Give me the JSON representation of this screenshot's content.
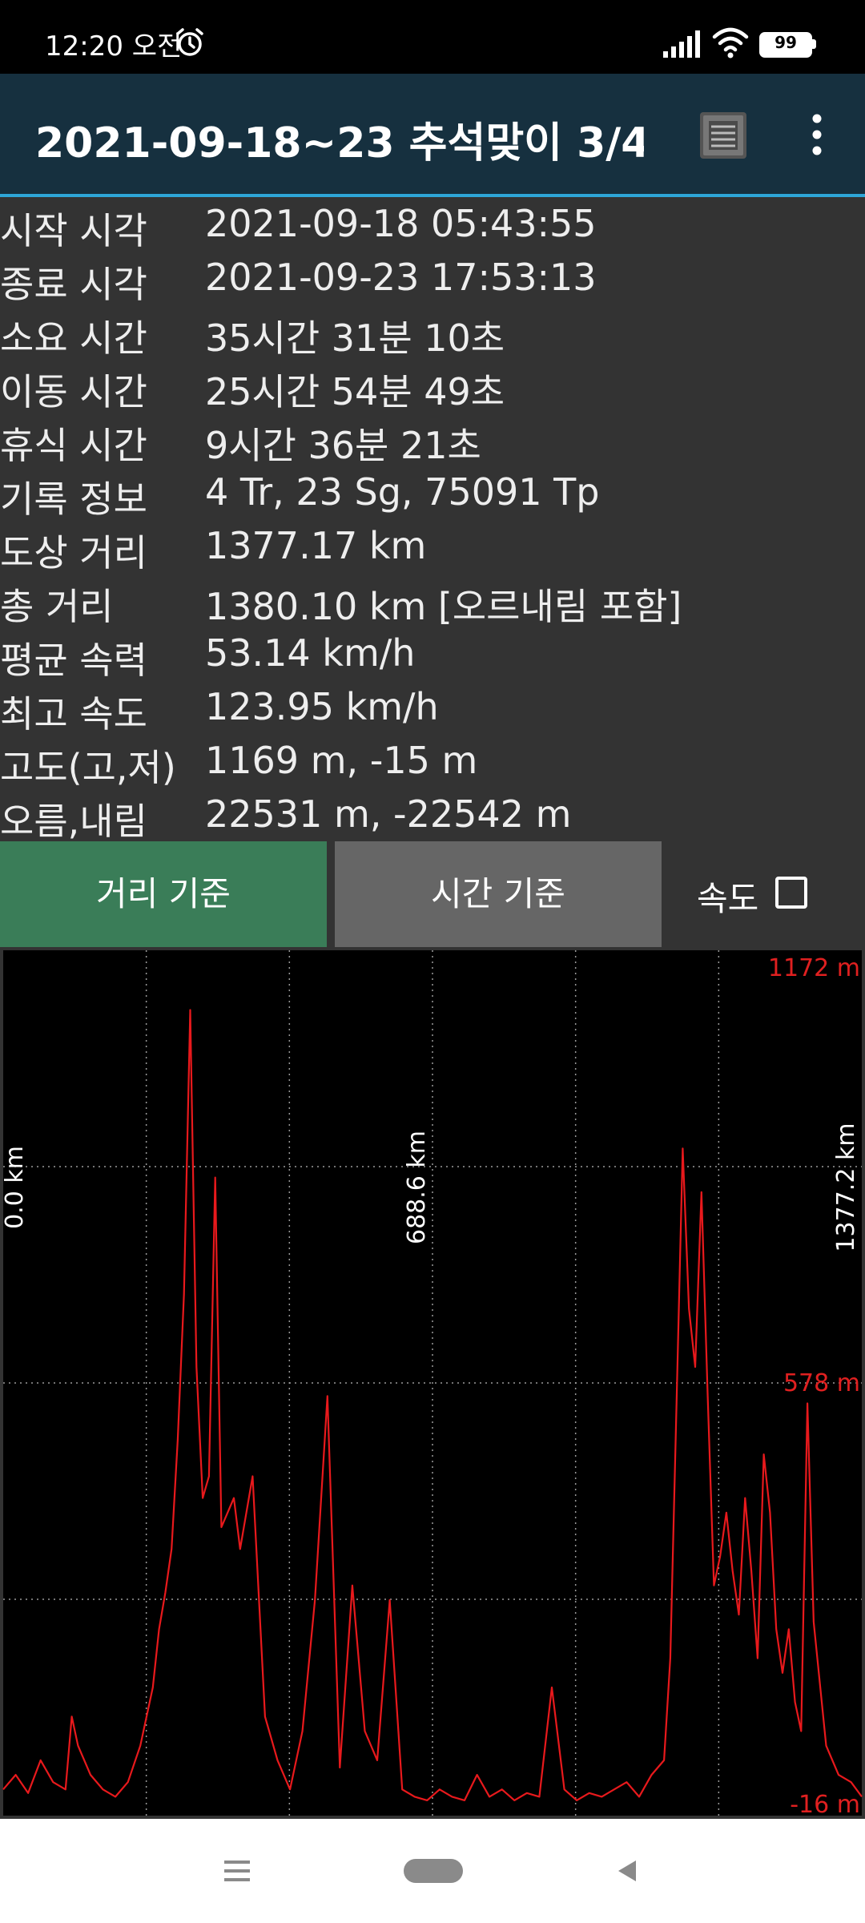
{
  "status_bar": {
    "time": "12:20 오전",
    "battery": "99"
  },
  "header": {
    "title": "2021-09-18~23 추석맞이 3/4..."
  },
  "info_rows": [
    {
      "label": "시작 시각",
      "value": "2021-09-18 05:43:55"
    },
    {
      "label": "종료 시각",
      "value": "2021-09-23 17:53:13"
    },
    {
      "label": "소요 시간",
      "value": "35시간 31분 10초"
    },
    {
      "label": "이동 시간",
      "value": "25시간 54분 49초"
    },
    {
      "label": "휴식 시간",
      "value": "9시간 36분 21초"
    },
    {
      "label": "기록 정보",
      "value": "4 Tr, 23 Sg, 75091 Tp"
    },
    {
      "label": "도상 거리",
      "value": "1377.17 km"
    },
    {
      "label": "총 거리",
      "value": "1380.10 km [오르내림 포함]"
    },
    {
      "label": "평균 속력",
      "value": "53.14 km/h"
    },
    {
      "label": "최고 속도",
      "value": "123.95 km/h"
    },
    {
      "label": "고도(고,저)",
      "value": "1169 m, -15 m"
    },
    {
      "label": "오름,내림",
      "value": "22531 m, -22542 m"
    }
  ],
  "tabs": {
    "distance": "거리 기준",
    "time": "시간 기준",
    "speed_label": "속도",
    "speed_checked": false
  },
  "colors": {
    "line": "#e8191c",
    "axis_label": "#e02020",
    "tab_active": "#3a7d58",
    "tab_inactive": "#666666"
  },
  "chart_data": {
    "type": "line",
    "x_tick_labels": [
      "0.0 km",
      "688.6 km",
      "1377.2 km"
    ],
    "y_tick_labels": [
      "1172 m",
      "578 m",
      "-16 m"
    ],
    "xlim": [
      0,
      1377.2
    ],
    "ylim": [
      -16,
      1172
    ],
    "grid": true,
    "series": [
      {
        "x": [
          0,
          20,
          40,
          60,
          80,
          100,
          110,
          120,
          140,
          160,
          180,
          200,
          220,
          240,
          250,
          260,
          270,
          280,
          290,
          300,
          310,
          320,
          330,
          340,
          350,
          360,
          370,
          380,
          400,
          420,
          440,
          460,
          480,
          500,
          520,
          540,
          560,
          580,
          600,
          620,
          640,
          660,
          680,
          700,
          720,
          740,
          760,
          780,
          800,
          820,
          840,
          860,
          880,
          900,
          920,
          940,
          960,
          980,
          1000,
          1020,
          1040,
          1060,
          1070,
          1080,
          1090,
          1100,
          1110,
          1120,
          1130,
          1140,
          1150,
          1160,
          1170,
          1180,
          1190,
          1200,
          1210,
          1220,
          1230,
          1240,
          1250,
          1260,
          1270,
          1280,
          1290,
          1300,
          1320,
          1340,
          1360,
          1377.2
        ],
        "y": [
          20,
          40,
          15,
          60,
          30,
          20,
          120,
          80,
          40,
          20,
          10,
          30,
          80,
          160,
          240,
          290,
          350,
          500,
          700,
          1090,
          600,
          420,
          450,
          860,
          380,
          400,
          420,
          350,
          450,
          120,
          60,
          20,
          100,
          280,
          560,
          50,
          300,
          100,
          60,
          280,
          20,
          10,
          5,
          20,
          10,
          5,
          40,
          10,
          20,
          5,
          15,
          10,
          160,
          20,
          5,
          15,
          10,
          20,
          30,
          10,
          40,
          60,
          200,
          550,
          900,
          680,
          600,
          840,
          560,
          300,
          340,
          400,
          320,
          260,
          420,
          320,
          200,
          480,
          400,
          240,
          180,
          240,
          140,
          100,
          550,
          250,
          80,
          40,
          30,
          10
        ]
      }
    ]
  }
}
